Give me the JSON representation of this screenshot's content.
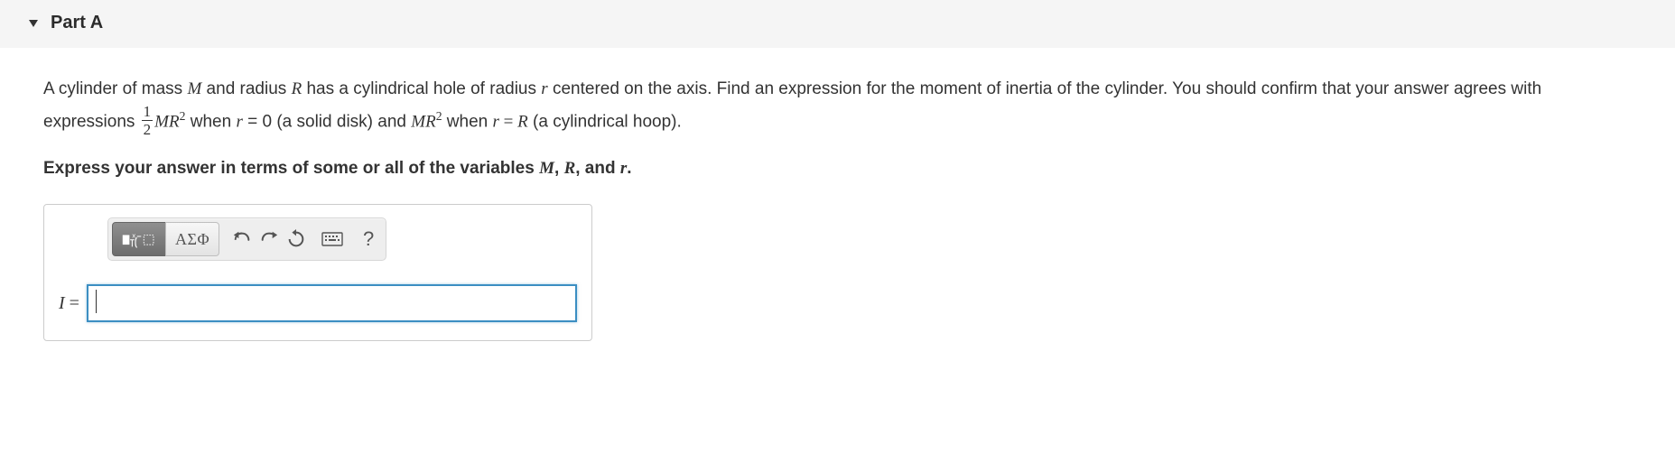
{
  "header": {
    "partLabel": "Part A"
  },
  "prompt": {
    "t1": "A cylinder of mass ",
    "M": "M",
    "t2": " and radius ",
    "R": "R",
    "t3": " has a cylindrical hole of radius ",
    "r": "r",
    "t4": " centered on the axis. Find an expression for the moment of inertia of the cylinder. You should confirm that your answer agrees with expressions ",
    "fracNum": "1",
    "fracDen": "2",
    "MR2a": "M",
    "MR2b": "R",
    "sup2": "2",
    "t5": " when ",
    "rEq0_r": "r",
    "rEq0_eq": " = 0 (a solid disk) and ",
    "MR2c": "M",
    "MR2d": "R",
    "t6": " when ",
    "rEqR_r": "r",
    "rEqR_eq": " = ",
    "rEqR_R": "R",
    "t7": " (a cylindrical hoop)."
  },
  "instructions": {
    "t1": "Express your answer in terms of some or all of the variables ",
    "M": "M",
    "comma1": ", ",
    "R": "R",
    "comma2": ", and ",
    "r": "r",
    "period": "."
  },
  "toolbar": {
    "greekLabel": "ΑΣΦ",
    "helpLabel": "?"
  },
  "input": {
    "lhsVar": "I",
    "lhsEq": " = ",
    "value": ""
  }
}
